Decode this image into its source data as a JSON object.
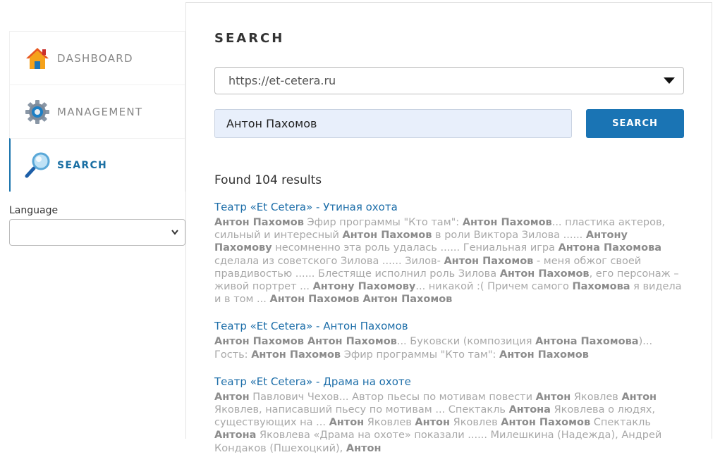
{
  "sidebar": {
    "items": [
      {
        "label": "DASHBOARD",
        "icon": "home-icon",
        "active": false
      },
      {
        "label": "MANAGEMENT",
        "icon": "gear-icon",
        "active": false
      },
      {
        "label": "SEARCH",
        "icon": "magnifier-icon",
        "active": true
      }
    ],
    "language_label": "Language",
    "language_value": ""
  },
  "main": {
    "heading": "SEARCH",
    "site_select_value": "https://et-cetera.ru",
    "query_value": "Антон Пахомов",
    "search_button": "SEARCH",
    "found_text": "Found 104 results"
  },
  "results": [
    {
      "title": "Театр «Et Cetera» - Утиная охота",
      "snippet": [
        {
          "t": "Антон Пахомов",
          "b": true
        },
        {
          "t": " Эфир программы \"Кто там\": ",
          "b": false
        },
        {
          "t": "Антон Пахомов",
          "b": true
        },
        {
          "t": "... пластика актеров, сильный и интересный ",
          "b": false
        },
        {
          "t": "Антон Пахомов",
          "b": true
        },
        {
          "t": " в роли Виктора Зилова ...... ",
          "b": false
        },
        {
          "t": "Антону Пахомову",
          "b": true
        },
        {
          "t": " несомненно эта роль удалась ...... Гениальная игра ",
          "b": false
        },
        {
          "t": "Антона Пахомова",
          "b": true
        },
        {
          "t": " сделала из советского Зилова ...... Зилов- ",
          "b": false
        },
        {
          "t": "Антон Пахомов",
          "b": true
        },
        {
          "t": " - меня обжог своей правдивостью ...... Блестяще исполнил роль Зилова ",
          "b": false
        },
        {
          "t": "Антон Пахомов",
          "b": true
        },
        {
          "t": ", его персонаж – живой портрет ... ",
          "b": false
        },
        {
          "t": "Антону Пахомову",
          "b": true
        },
        {
          "t": "... никакой :( Причем самого ",
          "b": false
        },
        {
          "t": "Пахомова",
          "b": true
        },
        {
          "t": " я видела и в том ... ",
          "b": false
        },
        {
          "t": "Антон Пахомов Антон Пахомов",
          "b": true
        }
      ]
    },
    {
      "title": "Театр «Et Cetera» - Антон Пахомов",
      "snippet": [
        {
          "t": "Антон Пахомов Антон Пахомов",
          "b": true
        },
        {
          "t": "... Буковски (композиция ",
          "b": false
        },
        {
          "t": "Антона Пахомова",
          "b": true
        },
        {
          "t": ")... Гость: ",
          "b": false
        },
        {
          "t": "Антон Пахомов",
          "b": true
        },
        {
          "t": " Эфир программы \"Кто там\": ",
          "b": false
        },
        {
          "t": "Антон Пахомов",
          "b": true
        }
      ]
    },
    {
      "title": "Театр «Et Cetera» - Драма на охоте",
      "snippet": [
        {
          "t": "Антон",
          "b": true
        },
        {
          "t": " Павлович Чехов... Автор пьесы по мотивам повести ",
          "b": false
        },
        {
          "t": "Антон",
          "b": true
        },
        {
          "t": " Яковлев ",
          "b": false
        },
        {
          "t": "Антон",
          "b": true
        },
        {
          "t": " Яковлев, написавший пьесу по мотивам ... Спектакль ",
          "b": false
        },
        {
          "t": "Антона",
          "b": true
        },
        {
          "t": " Яковлева о людях, существующих на ... ",
          "b": false
        },
        {
          "t": "Антон",
          "b": true
        },
        {
          "t": " Яковлев ",
          "b": false
        },
        {
          "t": "Антон",
          "b": true
        },
        {
          "t": " Яковлев ",
          "b": false
        },
        {
          "t": "Антон Пахомов",
          "b": true
        },
        {
          "t": " Спектакль ",
          "b": false
        },
        {
          "t": "Антона",
          "b": true
        },
        {
          "t": " Яковлева «Драма на охоте» показали ...... Милешкина (Надежда), Андрей Кондаков (Пшехоцкий), ",
          "b": false
        },
        {
          "t": "Антон",
          "b": true
        }
      ]
    }
  ],
  "colors": {
    "accent": "#1a74b4",
    "link": "#1d6ea9"
  }
}
